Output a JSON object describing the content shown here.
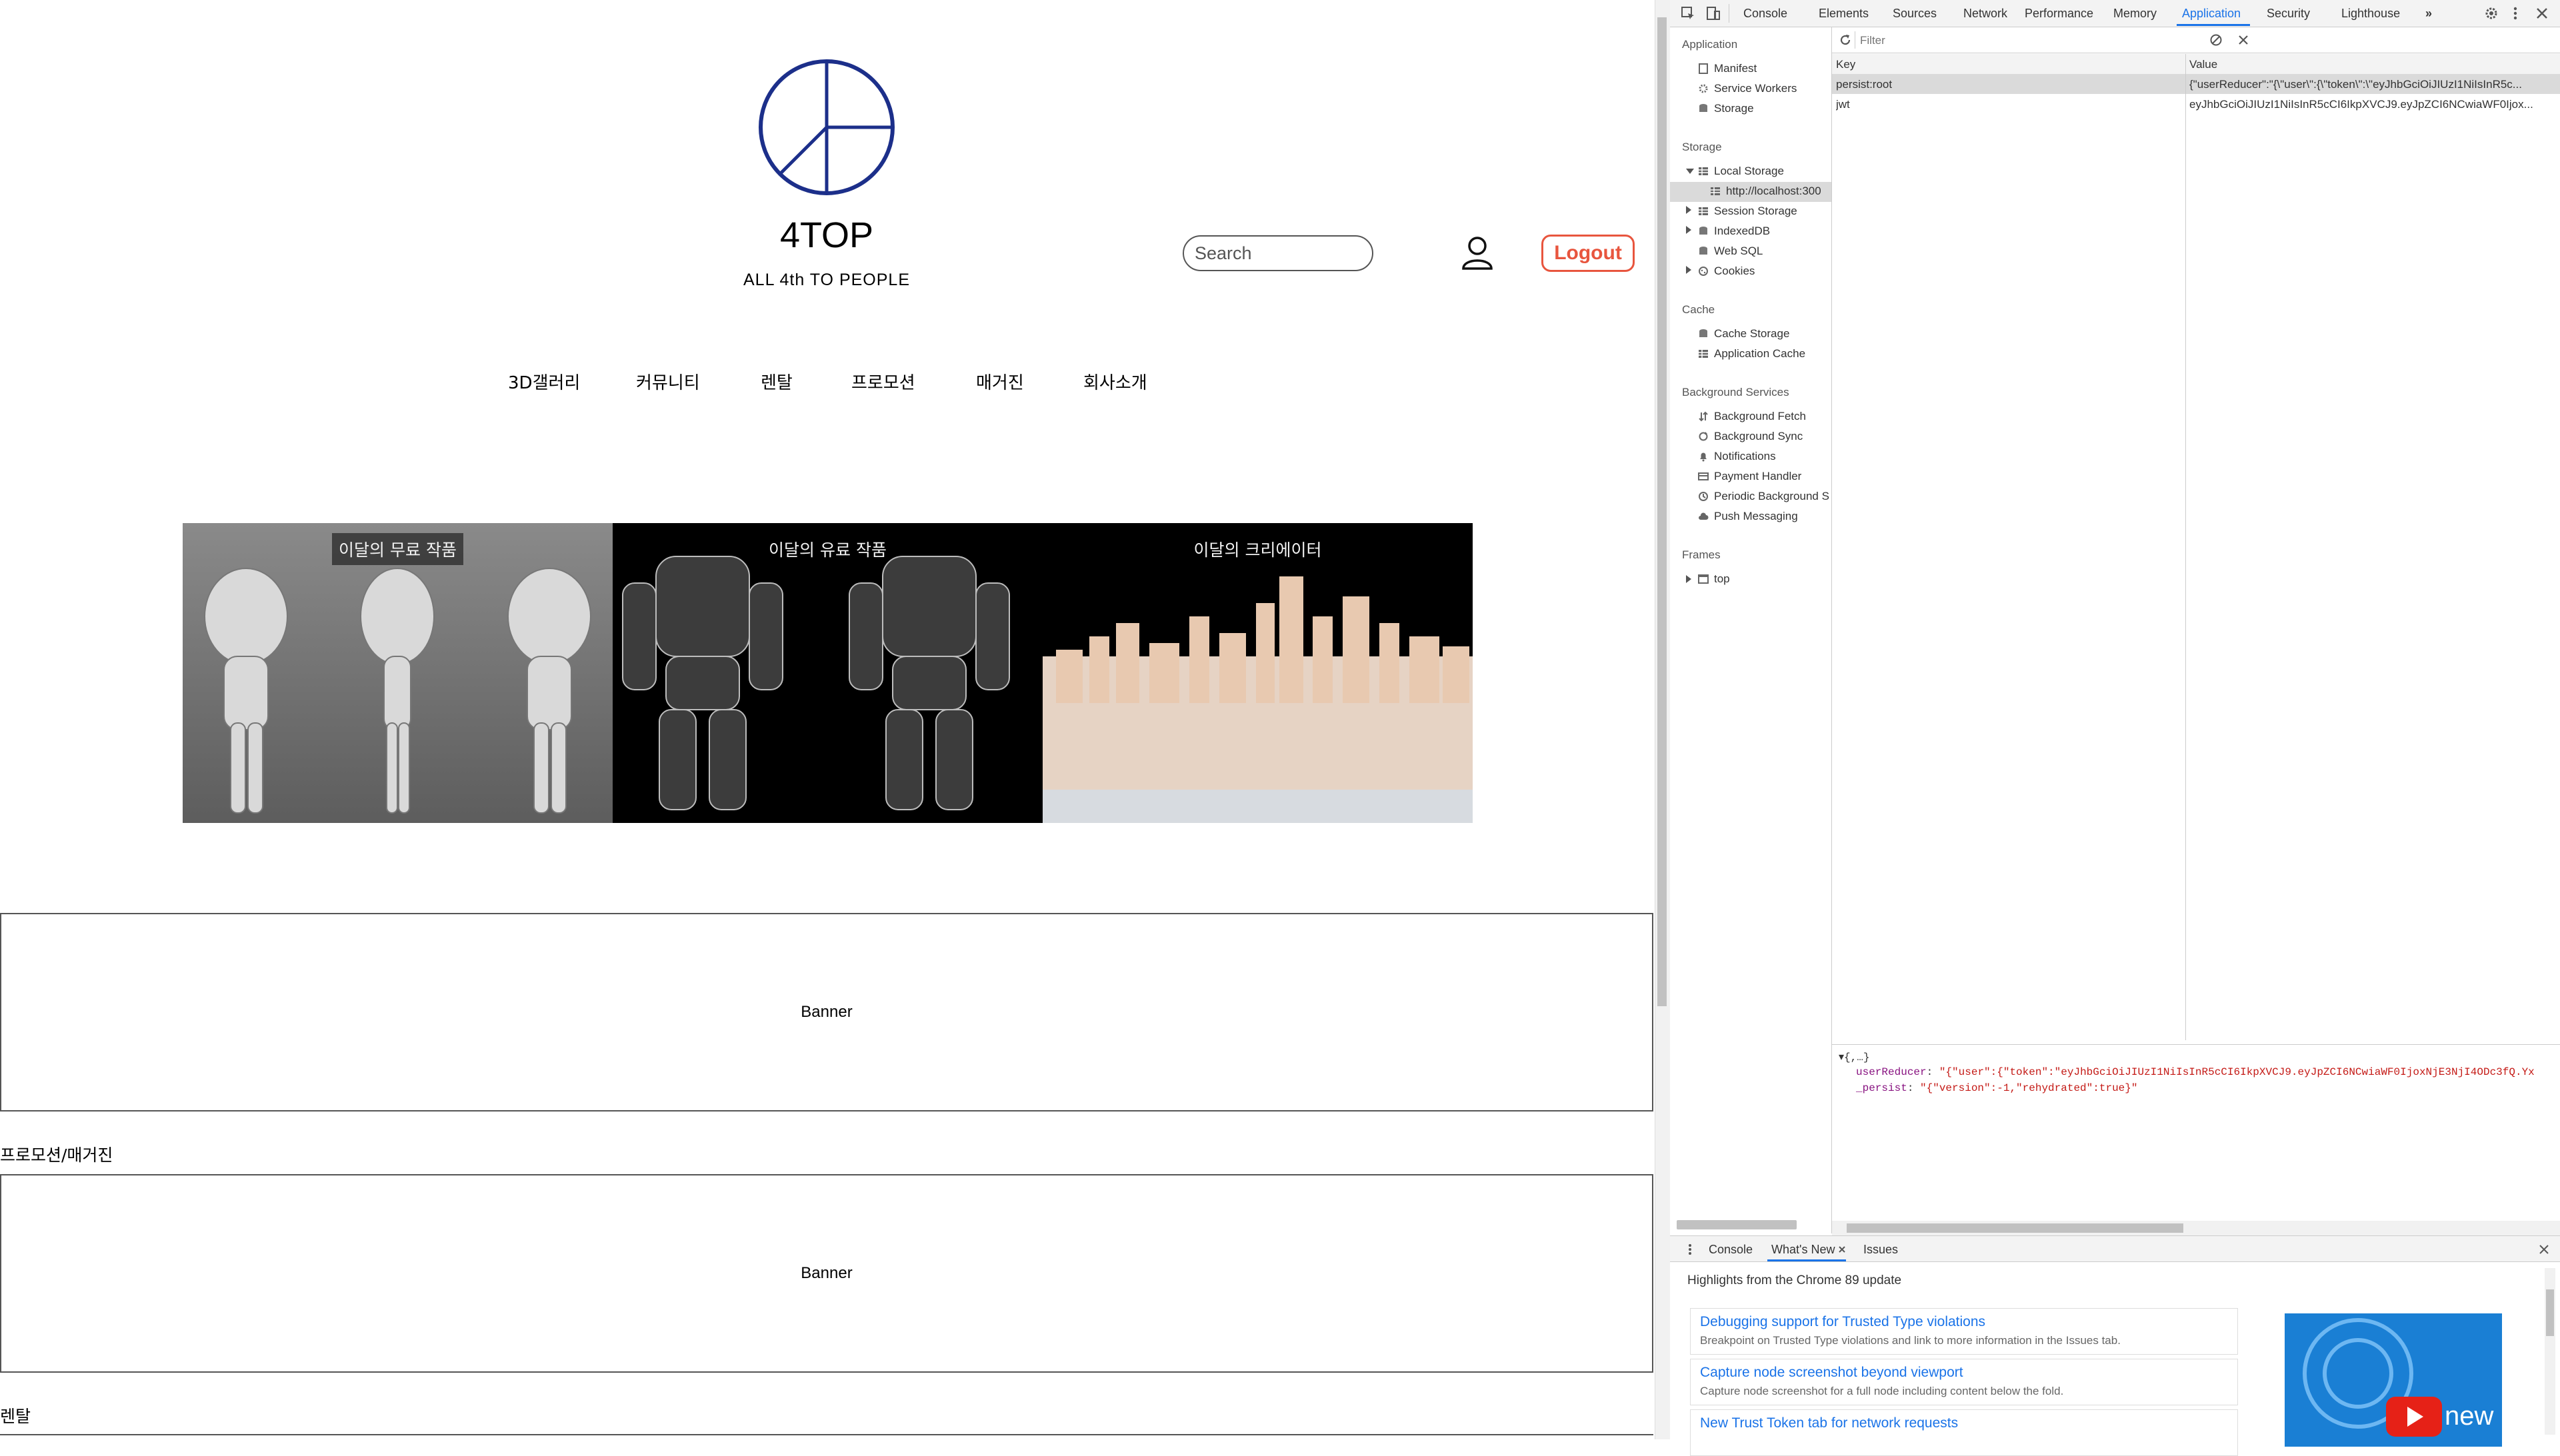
{
  "site": {
    "title": "4TOP",
    "subtitle": "ALL 4th TO PEOPLE",
    "search_placeholder": "Search",
    "logout_label": "Logout",
    "nav": [
      "3D갤러리",
      "커뮤니티",
      "렌탈",
      "프로모션",
      "매거진",
      "회사소개"
    ],
    "tiles": [
      {
        "caption": "이달의 무료 작품"
      },
      {
        "caption": "이달의 유료 작품"
      },
      {
        "caption": "이달의 크리에이터"
      }
    ],
    "banner1": "Banner",
    "section_promo": "프로모션/매거진",
    "banner2": "Banner",
    "section_rental": "렌탈"
  },
  "devtools": {
    "tabs": [
      "Console",
      "Elements",
      "Sources",
      "Network",
      "Performance",
      "Memory",
      "Application",
      "Security",
      "Lighthouse"
    ],
    "active_tab": "Application",
    "more": "»",
    "sidebar": {
      "application_head": "Application",
      "application_items": [
        "Manifest",
        "Service Workers",
        "Storage"
      ],
      "storage_head": "Storage",
      "local_storage": "Local Storage",
      "local_origin": "http://localhost:300",
      "storage_items": [
        "Session Storage",
        "IndexedDB",
        "Web SQL",
        "Cookies"
      ],
      "cache_head": "Cache",
      "cache_items": [
        "Cache Storage",
        "Application Cache"
      ],
      "bg_head": "Background Services",
      "bg_items": [
        "Background Fetch",
        "Background Sync",
        "Notifications",
        "Payment Handler",
        "Periodic Background S",
        "Push Messaging"
      ],
      "frames_head": "Frames",
      "frames_items": [
        "top"
      ]
    },
    "filter_placeholder": "Filter",
    "columns": {
      "key": "Key",
      "value": "Value"
    },
    "rows": [
      {
        "key": "persist:root",
        "value": "{\"userReducer\":\"{\\\"user\\\":{\\\"token\\\":\\\"eyJhbGciOiJIUzI1NiIsInR5c..."
      },
      {
        "key": "jwt",
        "value": "eyJhbGciOiJIUzI1NiIsInR5cCI6IkpXVCJ9.eyJpZCI6NCwiaWF0Ijox..."
      }
    ],
    "preview": {
      "root": "▾{,…}",
      "line1_key": "userReducer",
      "line1_val": "\"{\"user\":{\"token\":\"eyJhbGciOiJIUzI1NiIsInR5cCI6IkpXVCJ9.eyJpZCI6NCwiaWF0IjoxNjE3NjI4ODc3fQ.Yx",
      "line2_key": "_persist",
      "line2_val": "\"{\"version\":-1,\"rehydrated\":true}\""
    },
    "drawer": {
      "tabs": [
        "Console",
        "What's New",
        "Issues"
      ],
      "active_tab": "What's New",
      "highlight": "Highlights from the Chrome 89 update",
      "cards": [
        {
          "title": "Debugging support for Trusted Type violations",
          "desc": "Breakpoint on Trusted Type violations and link to more information in the Issues tab."
        },
        {
          "title": "Capture node screenshot beyond viewport",
          "desc": "Capture node screenshot for a full node including content below the fold."
        },
        {
          "title": "New Trust Token tab for network requests",
          "desc": ""
        }
      ],
      "video_label": "new"
    }
  }
}
